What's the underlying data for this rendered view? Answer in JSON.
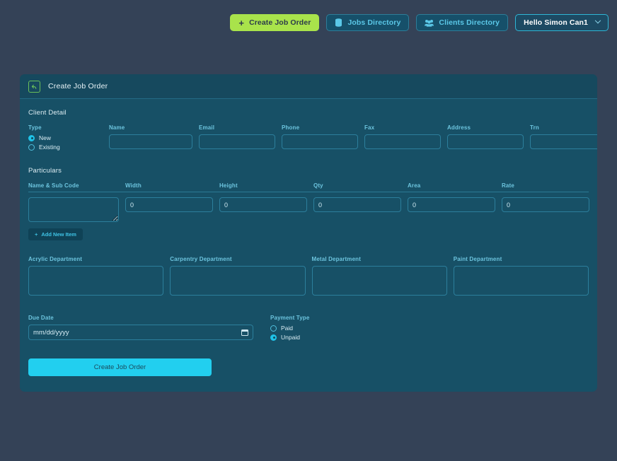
{
  "topnav": {
    "create_button": {
      "label": "Create Job Order",
      "icon": "plus-icon"
    },
    "jobs_button": {
      "label": "Jobs Directory",
      "icon": "database-icon"
    },
    "clients_button": {
      "label": "Clients Directory",
      "icon": "people-group-icon"
    },
    "user_menu": {
      "label": "Hello Simon Can1",
      "icon": "chevron-down-icon"
    }
  },
  "card": {
    "header_title": "Create Job Order",
    "back_icon": "back-arrow-icon",
    "client_detail": {
      "section_title": "Client Detail",
      "type_label": "Type",
      "type_options": [
        {
          "label": "New",
          "selected": true
        },
        {
          "label": "Existing",
          "selected": false
        }
      ],
      "fields": [
        {
          "label": "Name",
          "value": ""
        },
        {
          "label": "Email",
          "value": ""
        },
        {
          "label": "Phone",
          "value": ""
        },
        {
          "label": "Fax",
          "value": ""
        },
        {
          "label": "Address",
          "value": ""
        },
        {
          "label": "Trn",
          "value": ""
        }
      ]
    },
    "particulars": {
      "section_title": "Particulars",
      "columns": [
        "Name & Sub Code",
        "Width",
        "Height",
        "Qty",
        "Area",
        "Rate"
      ],
      "row": {
        "name_sub_code": "",
        "width": "0",
        "height": "0",
        "qty": "0",
        "area": "0",
        "rate": "0",
        "delete_icon": "trash-icon"
      },
      "add_button": {
        "label": "Add New Item",
        "icon": "plus-icon"
      }
    },
    "departments": [
      {
        "label": "Acrylic Department",
        "value": ""
      },
      {
        "label": "Carpentry Department",
        "value": ""
      },
      {
        "label": "Metal Department",
        "value": ""
      },
      {
        "label": "Paint Department",
        "value": ""
      }
    ],
    "due_date": {
      "label": "Due Date",
      "placeholder": "mm/dd/yyyy",
      "value": "",
      "icon": "calendar-icon"
    },
    "payment_type": {
      "label": "Payment Type",
      "options": [
        {
          "label": "Paid",
          "selected": false
        },
        {
          "label": "Unpaid",
          "selected": true
        }
      ]
    },
    "submit_button": {
      "label": "Create Job Order"
    }
  },
  "colors": {
    "page_bg": "#344257",
    "card_bg": "#175066",
    "accent_green": "#a9e34b",
    "accent_cyan": "#22cfef",
    "label_blue": "#6cc4de",
    "danger_red": "#b4473f"
  }
}
